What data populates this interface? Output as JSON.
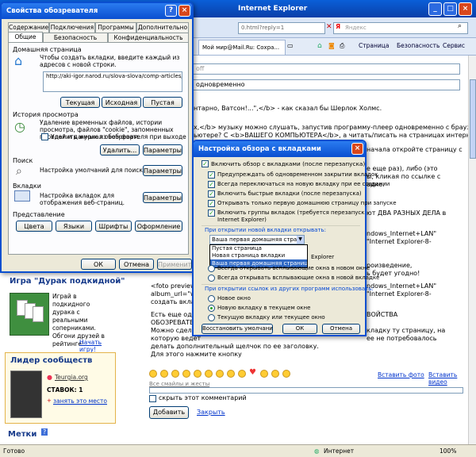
{
  "ie": {
    "title": "Internet Explorer",
    "url_fragment": "0.html?reply=1",
    "search_placeholder": "Яндекс",
    "tab_title": "Мой мир@Mail.Ru: Сохра...",
    "cmd_page": "Страница",
    "cmd_security": "Безопасность",
    "cmd_service": "Сервис",
    "status_left": "Готово",
    "status_zone": "Интернет",
    "status_zoom": "100%"
  },
  "page": {
    "line_off": "off",
    "line_simul": "одновременно",
    "p1": "нтарно, Ватсон!...\",</b> - как сказал бы Шерлок Холмс.",
    "p2": "х,</b> музыку можно слушать, запустив программу-плеер одновременно с браузером.",
    "p3": "ьютере? С <b>ВАШЕГО КОМПЬЮТЕРА</b>, а читать/писать на страницах интернета.",
    "p4": "начала откройте страницу с",
    "p5": "е еще раз), либо (это",
    "p6": "ы, кликая по ссылке с",
    "p7": "адке.",
    "p8": "ют ДВА РАЗНЫХ ДЕЛА в",
    "p9": "ndows_Internet+LAN\"",
    "p10": "\"Internet Explorer-8-",
    "p11": "роизведение,",
    "p12": "ь будет угодно!",
    "p13": "ndows_Internet+LAN\"",
    "p14": "\"Internet Explorer-8-",
    "foto": "<foto preview=\"",
    "album": "album_url=\"wind",
    "create": "создать вкладк",
    "est": "Есть еще одна",
    "obozr": "ОБОЗРЕВАТЕЛ",
    "mozhno": "Можно сделат",
    "kotoruyu": "которую ведет",
    "svoystva": "ВОЙСТВА",
    "vkladku": "кладку ту страницу, на",
    "ne_potreb": "ее не потребовалось",
    "delat": "делать дополнительный щелчок по ее заголовку.",
    "dlya": "Для этого нажмите кнопку",
    "smiles_link": "Все смайлы и жесты",
    "insert_photo": "Вставить фото",
    "insert_video": "Вставить видео",
    "hide_comment": "скрыть этот комментарий",
    "add_button": "Добавить",
    "close_link": "Закрыть"
  },
  "game": {
    "title": "Игра \"Дурак подкидной\"",
    "desc": "Играй в подкидного дурака с реальными соперниками. Обгони друзей в рейтинге!",
    "play": "Начать игру!"
  },
  "leader": {
    "title": "Лидер сообществ",
    "site": "Teurgia.org",
    "bets": "СТАВОК: 1",
    "take": "занять это место"
  },
  "tags_title": "Метки",
  "options": {
    "title": "Свойства обозревателя",
    "tabs_row1": [
      "Содержание",
      "Подключения",
      "Программы",
      "Дополнительно"
    ],
    "tabs_row2": [
      "Общие",
      "Безопасность",
      "Конфиденциальность"
    ],
    "home_group": "Домашняя страница",
    "home_text": "Чтобы создать вкладки, введите каждый из адресов с новой строки.",
    "home_url": "http://aki-igor.narod.ru/slova-slova/comp-articles/0802_",
    "btn_current": "Текущая",
    "btn_original": "Исходная",
    "btn_blank": "Пустая",
    "history_group": "История просмотра",
    "history_text": "Удаление временных файлов, истории просмотра, файлов \"cookie\", запомненных паролей и данных из веб-форм.",
    "history_chk": "Удалить журнал обозревателя при выходе",
    "btn_delete": "Удалить...",
    "btn_params": "Параметры",
    "search_group": "Поиск",
    "search_text": "Настройка умолчаний для поиска.",
    "tabs_group": "Вкладки",
    "tabs_text": "Настройка вкладок для отображения веб-страниц.",
    "view_group": "Представление",
    "btn_colors": "Цвета",
    "btn_langs": "Языки",
    "btn_fonts": "Шрифты",
    "btn_design": "Оформление",
    "btn_ok": "ОК",
    "btn_cancel": "Отмена",
    "btn_apply": "Применить"
  },
  "tabbed": {
    "title": "Настройка обзора с вкладками",
    "enable": "Включить обзор с вкладками (после перезапуска)",
    "chk1": "Предупреждать об одновременном закрытии вкладок",
    "chk2": "Всегда переключаться на новую вкладку при ее создании",
    "chk3": "Включить быстрые вкладки (после перезапуска)",
    "chk4": "Открывать только первую домашнюю страницу при запуске",
    "chk5a": "Включить группы вкладок (требуется перезапуск",
    "chk5b": "Internet Explorer)",
    "new_tab_label": "При открытии новой вкладки открывать:",
    "select_value": "Ваша первая домашняя страница",
    "dropdown": [
      "Пустая страница",
      "Новая страница вкладки",
      "Ваша первая домашняя страница"
    ],
    "popup_tail": "Explorer",
    "r1": "Всегда открывать всплывающие окна в новом окне",
    "r2": "Всегда открывать всплывающие окна в новой вкладке",
    "other_label": "При открытии ссылок из других программ использовать:",
    "o1": "Новое окно",
    "o2": "Новую вкладку в текущем окне",
    "o3": "Текущую вкладку или текущее окно",
    "btn_defaults": "Восстановить умолчания",
    "btn_ok": "ОК",
    "btn_cancel": "Отмена"
  }
}
